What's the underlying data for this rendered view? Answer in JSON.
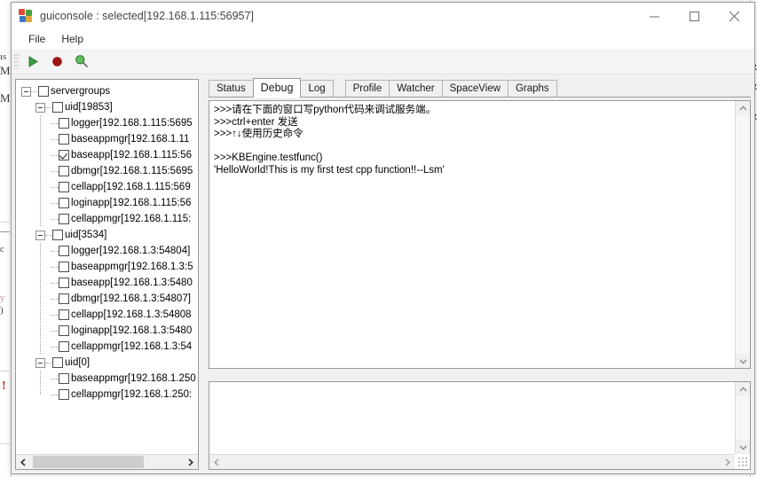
{
  "window": {
    "title": "guiconsole : selected[192.168.1.115:56957]",
    "icon": "app-icon",
    "controls": {
      "minimize": "minimize-icon",
      "maximize": "maximize-icon",
      "close": "close-icon"
    }
  },
  "menubar": {
    "items": [
      {
        "label": "File"
      },
      {
        "label": "Help"
      }
    ]
  },
  "toolbar": {
    "buttons": [
      {
        "name": "run-button",
        "icon": "play-triangle-icon",
        "color": "#2e8b35"
      },
      {
        "name": "stop-button",
        "icon": "stop-circle-icon",
        "color": "#9b1414"
      },
      {
        "name": "find-button",
        "icon": "magnifier-icon",
        "color": "#3f9b3f"
      }
    ]
  },
  "tree": {
    "root": {
      "label": "servergroups",
      "checked": false
    },
    "groups": [
      {
        "label": "uid[19853]",
        "checked": false,
        "children": [
          {
            "label": "logger[192.168.1.115:5695",
            "checked": false
          },
          {
            "label": "baseappmgr[192.168.1.11",
            "checked": false
          },
          {
            "label": "baseapp[192.168.1.115:56",
            "checked": true
          },
          {
            "label": "dbmgr[192.168.1.115:5695",
            "checked": false
          },
          {
            "label": "cellapp[192.168.1.115:569",
            "checked": false
          },
          {
            "label": "loginapp[192.168.1.115:56",
            "checked": false
          },
          {
            "label": "cellappmgr[192.168.1.115:",
            "checked": false
          }
        ]
      },
      {
        "label": "uid[3534]",
        "checked": false,
        "children": [
          {
            "label": "logger[192.168.1.3:54804]",
            "checked": false
          },
          {
            "label": "baseappmgr[192.168.1.3:5",
            "checked": false
          },
          {
            "label": "baseapp[192.168.1.3:5480",
            "checked": false
          },
          {
            "label": "dbmgr[192.168.1.3:54807]",
            "checked": false
          },
          {
            "label": "cellapp[192.168.1.3:54808",
            "checked": false
          },
          {
            "label": "loginapp[192.168.1.3:5480",
            "checked": false
          },
          {
            "label": "cellappmgr[192.168.1.3:54",
            "checked": false
          }
        ]
      },
      {
        "label": "uid[0]",
        "checked": false,
        "children": [
          {
            "label": "baseappmgr[192.168.1.250",
            "checked": false
          },
          {
            "label": "cellappmgr[192.168.1.250:",
            "checked": false
          }
        ]
      }
    ]
  },
  "tabs": [
    {
      "label": "Status",
      "active": false
    },
    {
      "label": "Debug",
      "active": true
    },
    {
      "label": "Log",
      "active": false
    },
    {
      "label": "Profile",
      "active": false
    },
    {
      "label": "Watcher",
      "active": false
    },
    {
      "label": "SpaceView",
      "active": false
    },
    {
      "label": "Graphs",
      "active": false
    }
  ],
  "console": {
    "output": ">>>请在下面的窗口写python代码来调试服务端。\n>>>ctrl+enter 发送\n>>>↑↓使用历史命令\n\n>>>KBEngine.testfunc()\n'HelloWorld!This is my first test cpp function!!--Lsm'",
    "input_value": "",
    "input_placeholder": ""
  },
  "background": {
    "left_fragments": [
      "ıs",
      "M",
      "M",
      "—",
      "c",
      "y",
      ")",
      "!"
    ],
    "right_fragments": [
      "R",
      "R",
      "R"
    ]
  },
  "colors": {
    "window_bg": "#f0f0f0",
    "panel_bg": "#ffffff",
    "border": "#9a9a9a",
    "text": "#000000",
    "title_text": "#444444",
    "accent_green": "#2e8b35",
    "accent_red": "#9b1414"
  }
}
